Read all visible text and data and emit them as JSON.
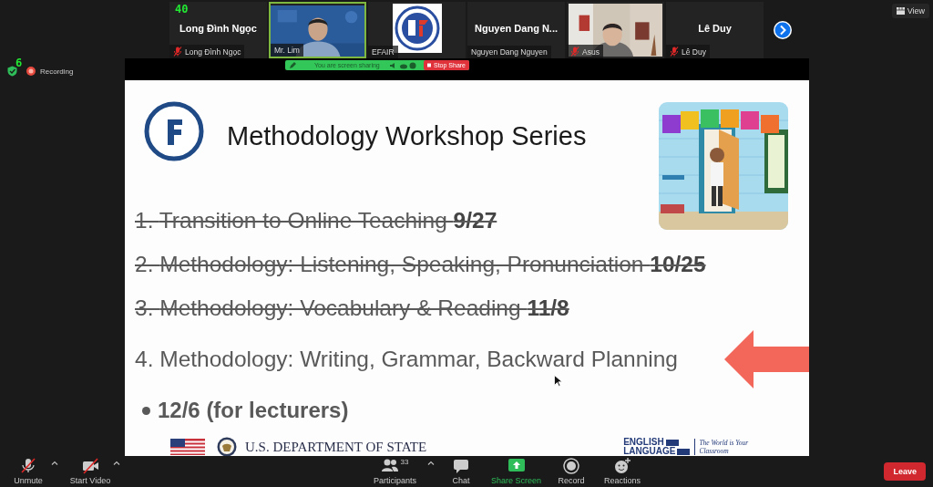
{
  "gallery_counter": "40",
  "gallery": [
    {
      "kind": "name",
      "display_name": "Long Đình Ngọc",
      "label": "Long Đình Ngọc",
      "muted": true,
      "speaking": false
    },
    {
      "kind": "video",
      "label": "Mr. Lim",
      "muted": false,
      "speaking": true
    },
    {
      "kind": "logo",
      "label": "EFAIR",
      "muted": false,
      "speaking": false
    },
    {
      "kind": "name",
      "display_name": "Nguyen Dang N...",
      "label": "Nguyen Dang Nguyen",
      "muted": false,
      "speaking": false
    },
    {
      "kind": "video",
      "label": "Asus",
      "muted": true,
      "speaking": false
    },
    {
      "kind": "name",
      "display_name": "Lê Duy",
      "label": "Lê Duy",
      "muted": true,
      "speaking": false
    }
  ],
  "view_button": "View",
  "status_counter": "6",
  "recording": {
    "label": "Recording"
  },
  "share_bar": {
    "message": "You are screen sharing",
    "stop_label": "Stop Share"
  },
  "slide": {
    "title": "Methodology Workshop Series",
    "items": [
      {
        "number": "1.",
        "text": "Transition to Online Teaching **9/27**",
        "done": true
      },
      {
        "number": "2.",
        "text": "Methodology: Listening, Speaking, Pronunciation **10/25**",
        "done": true
      },
      {
        "number": "3.",
        "text": "Methodology: Vocabulary & Reading **11/8**",
        "done": true
      },
      {
        "number": "4.",
        "text": "Methodology: Writing, Grammar, Backward Planning",
        "done": false
      }
    ],
    "bullet": "12/6 (for lecturers)",
    "agency": "U.S. DEPARTMENT OF STATE",
    "programs": [
      "ENGLISH",
      "LANGUAGE"
    ],
    "tagline": "The World is Your Classroom"
  },
  "toolbar": [
    {
      "kind": "mic",
      "label": "Unmute",
      "muted": true,
      "caret": true
    },
    {
      "kind": "video",
      "label": "Start Video",
      "muted": true,
      "caret": true
    },
    {
      "kind": "participants",
      "label": "Participants",
      "count": "33",
      "caret": true
    },
    {
      "kind": "chat",
      "label": "Chat",
      "caret": false
    },
    {
      "kind": "share",
      "label": "Share Screen",
      "caret": false
    },
    {
      "kind": "record",
      "label": "Record",
      "caret": false
    },
    {
      "kind": "reactions",
      "label": "Reactions",
      "caret": false
    }
  ],
  "leave_button": "Leave"
}
